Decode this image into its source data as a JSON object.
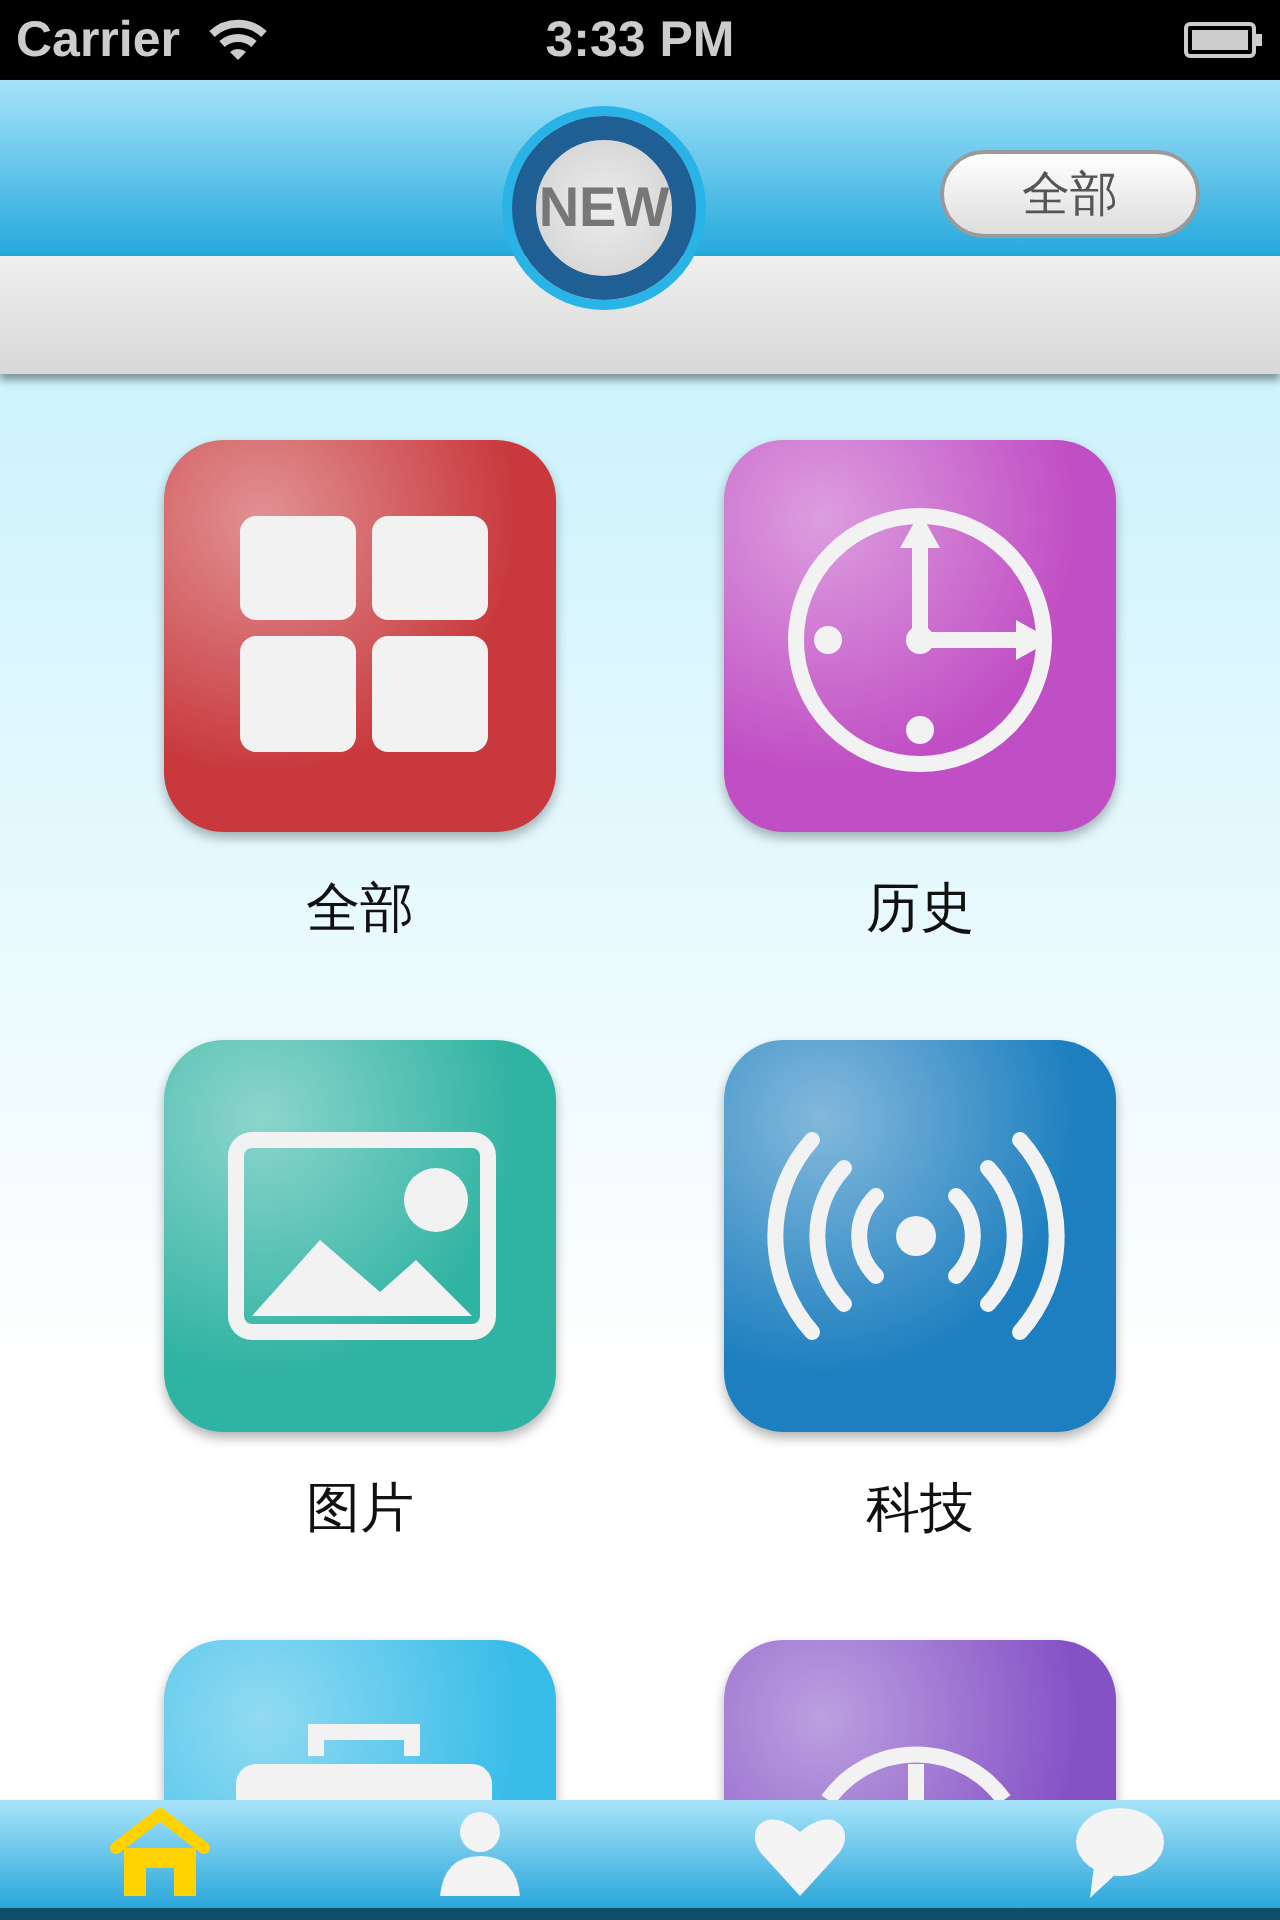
{
  "status_bar": {
    "carrier": "Carrier",
    "time": "3:33 PM"
  },
  "header": {
    "new_button": "NEW",
    "filter_button": "全部"
  },
  "tiles": [
    {
      "kind": "grid",
      "label": "全部",
      "color": "#c8383c"
    },
    {
      "kind": "clock",
      "label": "历史",
      "color": "#c04ec4"
    },
    {
      "kind": "image",
      "label": "图片",
      "color": "#2fb3a2"
    },
    {
      "kind": "signal",
      "label": "科技",
      "color": "#1d7fbf"
    },
    {
      "kind": "briefcase",
      "color": "#38bde8"
    },
    {
      "kind": "peace",
      "color": "#8552c6"
    }
  ],
  "tab_bar": [
    {
      "kind": "home",
      "selected": true
    },
    {
      "kind": "person",
      "selected": false
    },
    {
      "kind": "heart",
      "selected": false
    },
    {
      "kind": "chat",
      "selected": false
    }
  ]
}
